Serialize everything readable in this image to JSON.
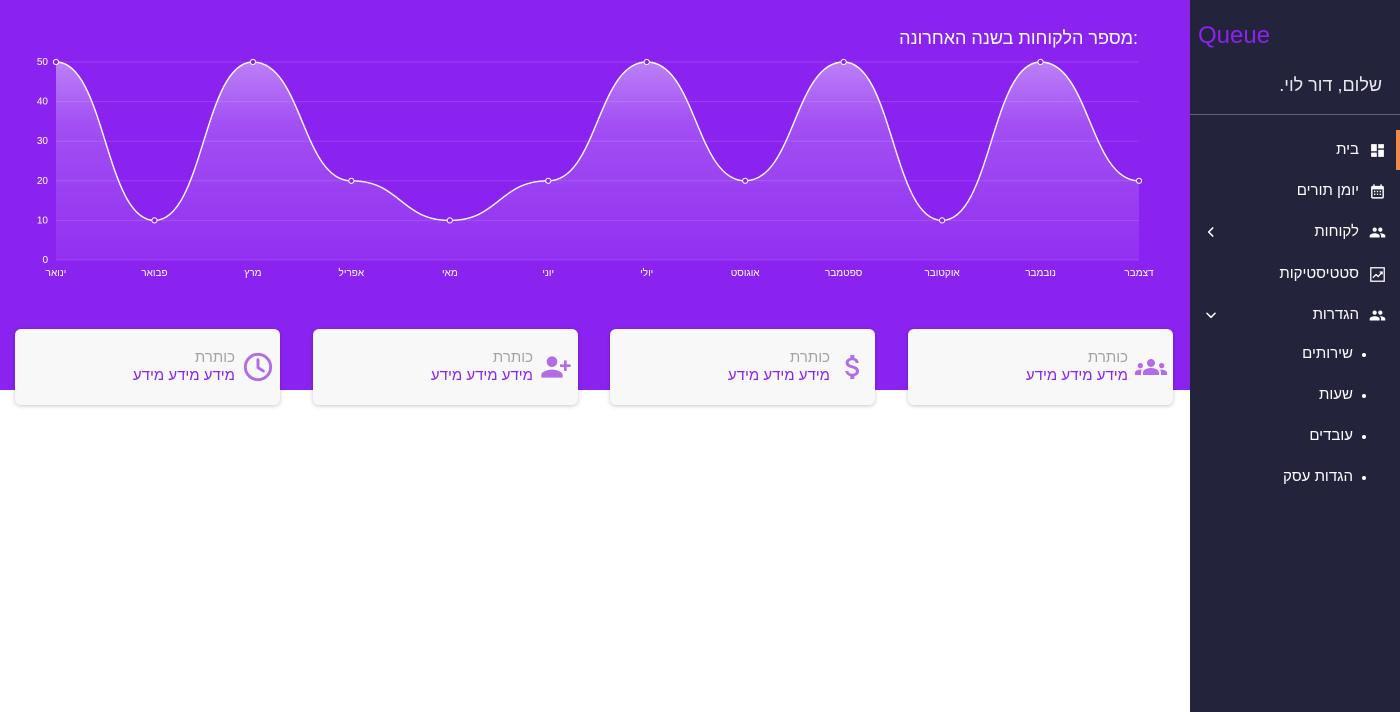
{
  "app": {
    "brand": "Queue",
    "greeting": "שלום, דור לוי."
  },
  "colors": {
    "primary": "#8b23f0",
    "sidebar": "#23233b",
    "active_indicator": "#f08a4b",
    "card_bg": "#f8f8f8",
    "card_icon": "#b26de6"
  },
  "nav": {
    "items": [
      {
        "label": "בית",
        "icon": "dashboard-icon",
        "active": true
      },
      {
        "label": "יומן תורים",
        "icon": "calendar-icon"
      },
      {
        "label": "לקוחות",
        "icon": "people-icon",
        "chevron": "chevron-left-icon"
      },
      {
        "label": "סטטיסטיקות",
        "icon": "trending-up-icon"
      },
      {
        "label": "הגדרות",
        "icon": "people-icon",
        "chevron": "chevron-down-icon",
        "expanded": true
      }
    ],
    "sub_items": [
      {
        "label": "שירותים"
      },
      {
        "label": "שעות"
      },
      {
        "label": "עובדים"
      },
      {
        "label": "הגדות עסק"
      }
    ]
  },
  "cards": [
    {
      "title": "כותרת",
      "value": "מידע מידע מידע",
      "icon": "group-icon"
    },
    {
      "title": "כותרת",
      "value": "מידע מידע מידע",
      "icon": "dollar-icon"
    },
    {
      "title": "כותרת",
      "value": "מידע מידע מידע",
      "icon": "person-add-icon"
    },
    {
      "title": "כותרת",
      "value": "מידע מידע מידע",
      "icon": "clock-icon"
    }
  ],
  "chart_data": {
    "type": "area",
    "title": ":מספר הלקוחות בשנה האחרונה",
    "categories": [
      "ינואר",
      "פבואר",
      "מרץ",
      "אפריל",
      "מאי",
      "יוני",
      "יולי",
      "אוגוסט",
      "ספטמבר",
      "אוקטובר",
      "נובמבר",
      "דצמבר"
    ],
    "values": [
      50,
      10,
      50,
      20,
      10,
      20,
      50,
      20,
      50,
      10,
      50,
      20
    ],
    "yticks": [
      0,
      10,
      20,
      30,
      40,
      50
    ],
    "ylim": [
      0,
      50
    ],
    "grid": true,
    "smooth": true,
    "xlabel": "",
    "ylabel": ""
  }
}
